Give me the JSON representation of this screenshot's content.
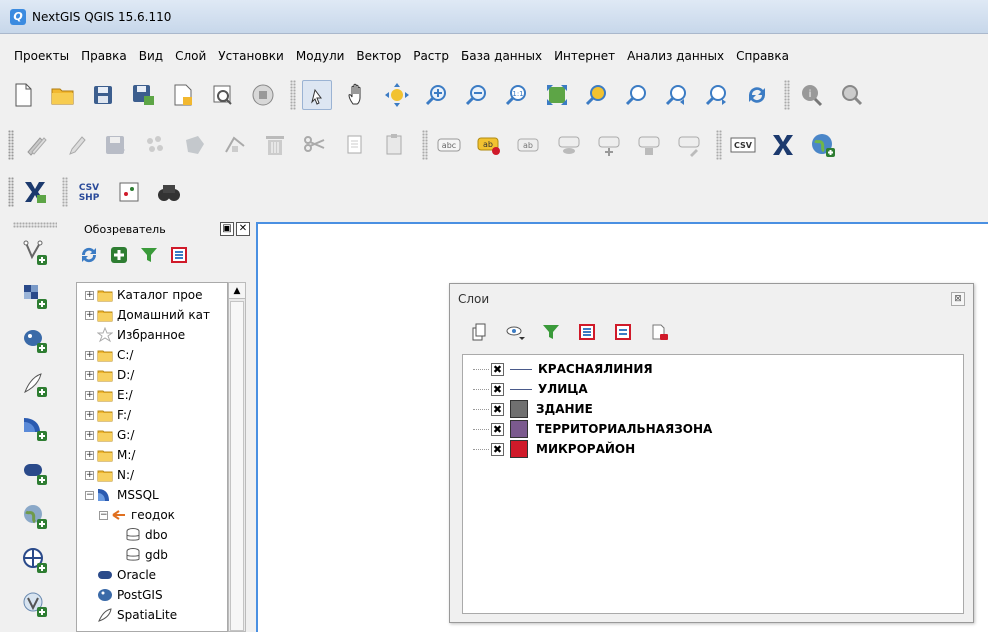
{
  "window": {
    "title": "NextGIS QGIS 15.6.110"
  },
  "menu": [
    "Проекты",
    "Правка",
    "Вид",
    "Слой",
    "Установки",
    "Модули",
    "Вектор",
    "Растр",
    "База данных",
    "Интернет",
    "Анализ данных",
    "Справка"
  ],
  "browser": {
    "title": "Обозреватель",
    "items": [
      {
        "label": "Каталог прое",
        "icon": "folder-icon",
        "expander": "+"
      },
      {
        "label": "Домашний кат",
        "icon": "folder-icon",
        "expander": "+"
      },
      {
        "label": "Избранное",
        "icon": "star-icon",
        "expander": ""
      },
      {
        "label": "C:/",
        "icon": "folder-icon",
        "expander": "+"
      },
      {
        "label": "D:/",
        "icon": "folder-icon",
        "expander": "+"
      },
      {
        "label": "E:/",
        "icon": "folder-icon",
        "expander": "+"
      },
      {
        "label": "F:/",
        "icon": "folder-icon",
        "expander": "+"
      },
      {
        "label": "G:/",
        "icon": "folder-icon",
        "expander": "+"
      },
      {
        "label": "M:/",
        "icon": "folder-icon",
        "expander": "+"
      },
      {
        "label": "N:/",
        "icon": "folder-icon",
        "expander": "+"
      },
      {
        "label": "MSSQL",
        "icon": "mssql-icon",
        "expander": "−"
      },
      {
        "label": "геодок",
        "icon": "connection-icon",
        "expander": "−",
        "indent": 1
      },
      {
        "label": "dbo",
        "icon": "database-icon",
        "expander": "",
        "indent": 2
      },
      {
        "label": "gdb",
        "icon": "database-icon",
        "expander": "",
        "indent": 2
      },
      {
        "label": "Oracle",
        "icon": "oracle-icon",
        "expander": ""
      },
      {
        "label": "PostGIS",
        "icon": "postgis-icon",
        "expander": ""
      },
      {
        "label": "SpatiaLite",
        "icon": "spatialite-icon",
        "expander": ""
      }
    ]
  },
  "layers": {
    "title": "Слои",
    "items": [
      {
        "name": "КРАСНАЯЛИНИЯ",
        "symbol": "line",
        "color": "#4a5a8a",
        "checked": "✖"
      },
      {
        "name": "УЛИЦА",
        "symbol": "line",
        "color": "#4a5a8a",
        "checked": "✖"
      },
      {
        "name": "ЗДАНИЕ",
        "symbol": "fill",
        "color": "#707070",
        "checked": "✖"
      },
      {
        "name": "ТЕРРИТОРИАЛЬНАЯЗОНА",
        "symbol": "fill",
        "color": "#7b5a8e",
        "checked": "✖"
      },
      {
        "name": "МИКРОРАЙОН",
        "symbol": "fill",
        "color": "#d01a2a",
        "checked": "✖"
      }
    ]
  },
  "toolbar_text": {
    "csv": "CSV",
    "csv_shp_top": "CSV",
    "csv_shp_bottom": "SHP",
    "abc": "abc",
    "scale": "1:1"
  }
}
